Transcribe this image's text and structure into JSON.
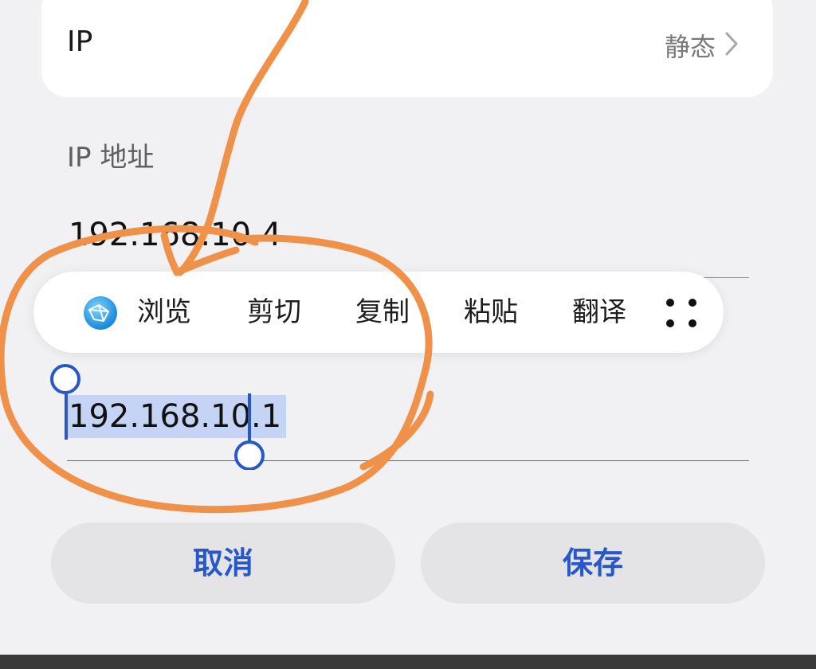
{
  "ip_setting": {
    "label": "IP",
    "value": "静态"
  },
  "ip_address": {
    "label": "IP 地址",
    "value": "192.168.10.4"
  },
  "context_menu": {
    "items": [
      "浏览",
      "剪切",
      "复制",
      "粘贴",
      "翻译"
    ],
    "icons": [
      "globe-icon",
      "more-icon"
    ]
  },
  "gateway_field": {
    "value": "192.168.10.1"
  },
  "buttons": {
    "cancel": "取消",
    "save": "保存"
  },
  "colors": {
    "accent": "#2857c9",
    "selection": "#c5d3f4",
    "annotation": "#f0914a",
    "background": "#f1f1f3"
  }
}
